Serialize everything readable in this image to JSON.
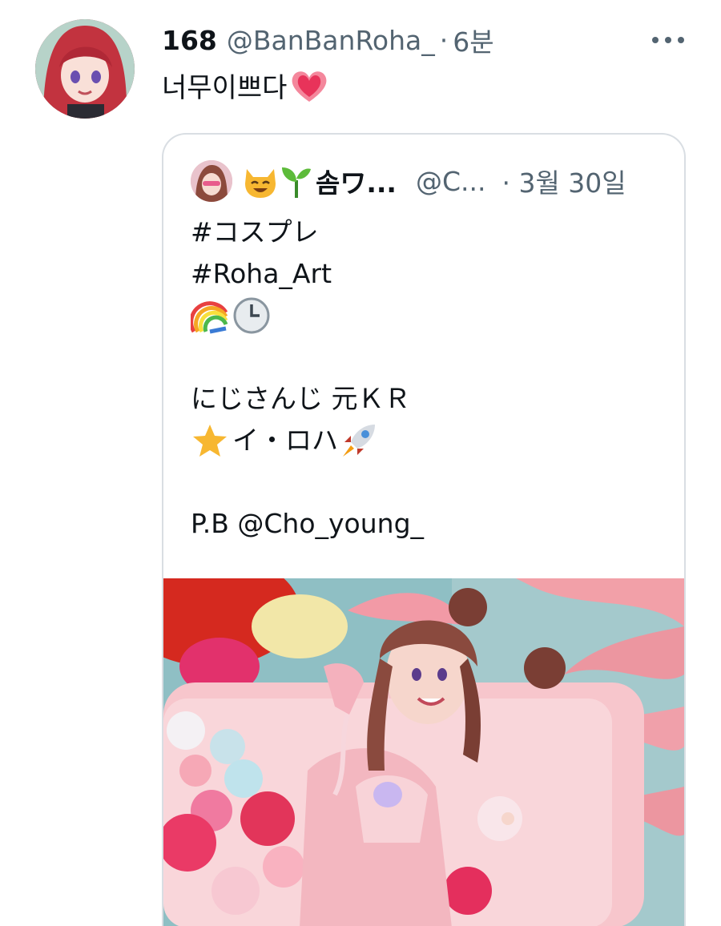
{
  "tweet": {
    "display_name": "168",
    "handle": "@BanBanRoha_",
    "separator": "·",
    "time": "6분",
    "text": "너무이쁘다",
    "text_emoji": "heart-emoji",
    "more_icon": "more-dots-icon"
  },
  "quoted": {
    "emoji_1": "smiling-cat-emoji",
    "emoji_2": "seedling-emoji",
    "display_name": "솜ワ...",
    "handle": "@C...",
    "time": "· 3월 30일",
    "lines": [
      "#コスプレ",
      "#Roha_Art",
      "",
      "",
      "にじさんじ 元ＫＲ",
      "イ・ロハ",
      "",
      "P.B @Cho_young_"
    ],
    "line_emojis": {
      "line3": [
        "rainbow-emoji",
        "clock-emoji"
      ],
      "line6_before": "star-emoji",
      "line6_after": "rocket-emoji"
    },
    "photo": "cosplay-photo"
  }
}
